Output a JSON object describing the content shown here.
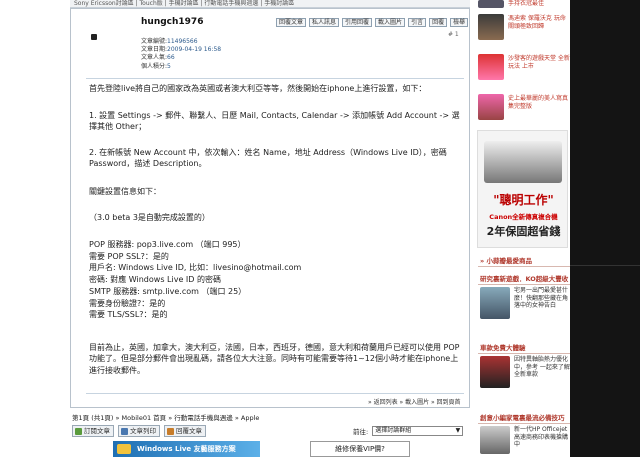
{
  "topstrip": "Sony Ericsson討論區 | Touch版 | 手機討論區 | 行動電話手機與週邊 | 手機討論區",
  "post": {
    "username": "hungch1976",
    "toolbar": [
      "回覆文章",
      "私人訊息",
      "引用回覆",
      "載入圖片",
      "引言",
      "回覆",
      "檢舉"
    ],
    "post_number": "# 1",
    "meta": [
      {
        "k": "文章編號:",
        "v": "11496566"
      },
      {
        "k": "文章日期:",
        "v": "2009-04-19 16:58"
      },
      {
        "k": "文章人氣:",
        "v": "66"
      },
      {
        "k": "個人積分:",
        "v": "5"
      }
    ],
    "content": [
      "首先登陸live將自己的國家改為英國或者澳大利亞等等，然後開始在iphone上進行設置，如下：",
      "1. 設置 Settings -> 郵件、聯繫人、日歷 Mail, Contacts, Calendar -> 添加帳號 Add Account -> 選擇其他 Other；",
      "2. 在新帳號 New Account 中，依次輸入：姓名 Name，地址 Address（Windows Live ID），密碼 Password，描述 Description。",
      "關鍵設置信息如下：",
      "（3.0 beta 3是自動完成設置的）",
      "POP 服務器: pop3.live.com （端口 995）\n需要 POP SSL?：是的\n用戶名: Windows Live ID, 比如：livesino@hotmail.com\n密碼: 對應 Windows Live ID 的密碼\nSMTP 服務器: smtp.live.com （端口 25）\n需要身份驗證?：是的\n需要 TLS/SSL?：是的",
      "目前為止，英國，加拿大，澳大利亞，法國，日本，西班牙，德國，意大利和荷蘭用戶已經可以使用 POP 功能了。但是部分郵件會出現亂碼，請各位大大注意。同時有可能需要等待1~12個小時才能在iphone上進行接收郵件。"
    ],
    "postlinks": "» 返回列表 » 載入圖片 » 回到頁首"
  },
  "breadcrumb": "第1頁 (共1頁) » Mobile01 首頁 » 行動電話手機與週邊 » Apple",
  "actions": [
    "訂閱文章",
    "文章列印",
    "回覆文章"
  ],
  "nav": {
    "label": "前往:",
    "selected": "選擇討論群組"
  },
  "banners": {
    "left": "Windows Live 友藝服務方案",
    "right": "維修保養VIP價?"
  },
  "sidebar": {
    "ads": [
      {
        "text": "手持衣冠最佳",
        "dark": false
      },
      {
        "text": "馮迪索 保羅沃克 玩命關頭極致回歸",
        "dark": false
      },
      {
        "text": "沙發客的遊戲天堂 全新玩法 上市",
        "dark": false
      },
      {
        "text": "史上最華麗的美人寫真集完整版",
        "dark": false
      }
    ],
    "bigad": {
      "slogan": "\"聰明工作\"",
      "brandline": "Canon全新傳真複合機",
      "warranty": "2年保固超省錢"
    },
    "sections": [
      {
        "header": "» 小蒜瓣最愛商品",
        "text": ""
      },
      {
        "header": "研究裏新遊戲．KO超級大豐收",
        "text": "宅男一出門最愛甚什麼！快翻那些藏在角落中的女神告白"
      },
      {
        "header": "車款免費大體驗",
        "text": "因特異軸胎熱力優化中，參考 一起來了解全新車款"
      },
      {
        "header": "創意小編家電裏最流必備技巧",
        "text": "新一代HP Officejet高速商務印表機搶購中"
      }
    ]
  }
}
